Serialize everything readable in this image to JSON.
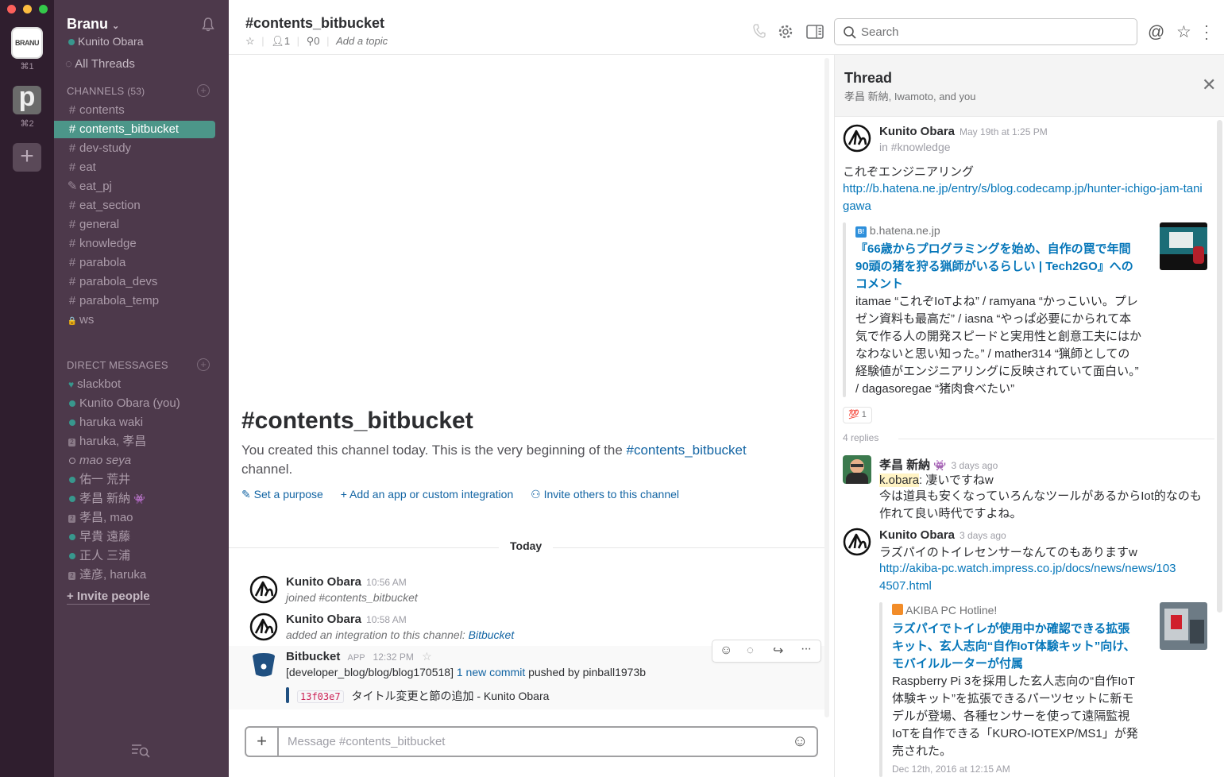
{
  "colors": {
    "sidebar": "#4d394b",
    "active_channel": "#4c9689",
    "link": "#0576b9",
    "presence": "#38978d"
  },
  "teams": [
    {
      "label": "BRANU",
      "key": "⌘1"
    },
    {
      "label": "p",
      "key": "⌘2"
    }
  ],
  "workspace": {
    "name": "Branu",
    "user": "Kunito Obara"
  },
  "sidebar": {
    "all_threads": "All Threads",
    "channels_label": "CHANNELS",
    "channels_count": "(53)",
    "channels": [
      {
        "name": "contents",
        "prefix": "#"
      },
      {
        "name": "contents_bitbucket",
        "prefix": "#"
      },
      {
        "name": "dev-study",
        "prefix": "#"
      },
      {
        "name": "eat",
        "prefix": "#"
      },
      {
        "name": "eat_pj",
        "prefix": "✎"
      },
      {
        "name": "eat_section",
        "prefix": "#"
      },
      {
        "name": "general",
        "prefix": "#"
      },
      {
        "name": "knowledge",
        "prefix": "#"
      },
      {
        "name": "parabola",
        "prefix": "#"
      },
      {
        "name": "parabola_devs",
        "prefix": "#"
      },
      {
        "name": "parabola_temp",
        "prefix": "#"
      },
      {
        "name": "ws",
        "prefix": "🔒"
      }
    ],
    "dm_label": "DIRECT MESSAGES",
    "dms": [
      {
        "name": "slackbot"
      },
      {
        "name": "Kunito Obara (you)"
      },
      {
        "name": "haruka waki"
      },
      {
        "name": "haruka, 孝昌"
      },
      {
        "name": "mao seya"
      },
      {
        "name": "佑一 荒井"
      },
      {
        "name": "孝昌 新納"
      },
      {
        "name": "孝昌, mao"
      },
      {
        "name": "早貴 遠藤"
      },
      {
        "name": "正人 三浦"
      },
      {
        "name": "達彦, haruka"
      }
    ],
    "invite": "+ Invite people"
  },
  "header": {
    "channel": "#contents_bitbucket",
    "members": "1",
    "pins": "0",
    "topic": "Add a topic",
    "search_placeholder": "Search"
  },
  "intro": {
    "title": "#contents_bitbucket",
    "text_before": "You created this channel today. This is the very beginning of the ",
    "channel_link": "#contents_bitbucket",
    "text_after": "channel.",
    "actions": [
      "Set a purpose",
      "Add an app or custom integration",
      "Invite others to this channel"
    ]
  },
  "divider": "Today",
  "messages": [
    {
      "name": "Kunito Obara",
      "time": "10:56 AM",
      "text": "joined #contents_bitbucket"
    },
    {
      "name": "Kunito Obara",
      "time": "10:58 AM",
      "text": "added an integration to this channel: ",
      "link": "Bitbucket"
    },
    {
      "name": "Bitbucket",
      "app": "APP",
      "time": "12:32 PM",
      "text_before": "[developer_blog/blog/blog170518] ",
      "link": "1 new commit",
      "text_after": " pushed by pinball1973b",
      "commit_hash": "13f03e7",
      "commit_msg": "タイトル変更と節の追加 - Kunito Obara"
    }
  ],
  "composer": {
    "placeholder": "Message #contents_bitbucket"
  },
  "thread": {
    "title": "Thread",
    "participants": "孝昌 新納, Iwamoto, and you",
    "parent": {
      "name": "Kunito Obara",
      "time": "May 19th at 1:25 PM",
      "channel": "in #knowledge",
      "text": "これぞエンジニアリング",
      "url": "http://b.hatena.ne.jp/entry/s/blog.codecamp.jp/hunter-ichigo-jam-tanigawa",
      "unfurl": {
        "site": "b.hatena.ne.jp",
        "title": "『66歳からプログラミングを始め、自作の罠で年間90頭の猪を狩る猟師がいるらしい | Tech2GO』へのコメント",
        "body": "itamae “これぞIoTよね” / ramyana “かっこいい。プレゼン資料も最高だ” / iasna “やっぱ必要にかられて本気で作る人の開発スピードと実用性と創意工夫にはかなわないと思い知った。” / mather314 “猟師としての経験値がエンジニアリングに反映されていて面白い。” / dagasoregae “猪肉食べたい”"
      },
      "reaction": "💯",
      "reaction_count": "1"
    },
    "replies_label": "4 replies",
    "replies": [
      {
        "name": "孝昌 新納",
        "time": "3 days ago",
        "mention": "k.obara",
        "line1": ": 凄いですねw",
        "line2": "今は道具も安くなっていろんなツールがあるからIot的なのも作れて良い時代ですよね。"
      },
      {
        "name": "Kunito Obara",
        "time": "3 days ago",
        "line1": "ラズパイのトイレセンサーなんてのもありますw",
        "url": "http://akiba-pc.watch.impress.co.jp/docs/news/news/1034507.html",
        "unfurl": {
          "site": "AKIBA PC Hotline!",
          "title": "ラズパイでトイレが使用中か確認できる拡張キット、玄人志向“自作IoT体験キット”向け、モバイルルーターが付属",
          "body": "Raspberry Pi 3を採用した玄人志向の“自作IoT体験キット”を拡張できるパーツセットに新モデルが登場、各種センサーを使って遠隔監視IoTを自作できる「KURO-IOTEXP/MS1」が発売された。",
          "date": "Dec 12th, 2016 at 12:15 AM"
        }
      }
    ]
  }
}
